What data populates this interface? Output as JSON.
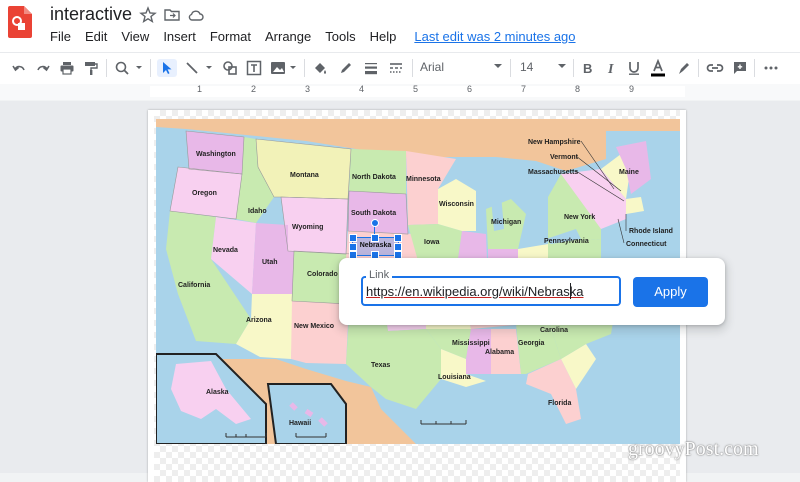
{
  "window": {
    "title": "interactive"
  },
  "menubar": {
    "items": [
      "File",
      "Edit",
      "View",
      "Insert",
      "Format",
      "Arrange",
      "Tools",
      "Help"
    ],
    "last_edit": "Last edit was 2 minutes ago"
  },
  "toolbar": {
    "font": "Arial",
    "font_size": "14",
    "icons": [
      "undo-icon",
      "redo-icon",
      "print-icon",
      "paint-format-icon",
      "zoom-icon",
      "select-icon",
      "line-icon",
      "shape-icon",
      "text-box-icon",
      "image-icon",
      "fill-color-icon",
      "border-color-icon",
      "border-weight-icon",
      "border-dash-icon",
      "bold-icon",
      "italic-icon",
      "underline-icon",
      "text-color-icon",
      "highlight-icon",
      "link-icon",
      "comment-icon",
      "more-icon"
    ]
  },
  "ruler": {
    "numbers": [
      "1",
      "2",
      "3",
      "4",
      "5",
      "6",
      "7",
      "8",
      "9"
    ]
  },
  "map": {
    "labels": {
      "washington": "Washington",
      "oregon": "Oregon",
      "california": "California",
      "nevada": "Nevada",
      "idaho": "Idaho",
      "montana": "Montana",
      "wyoming": "Wyoming",
      "utah": "Utah",
      "arizona": "Arizona",
      "colorado": "Colorado",
      "new_mexico": "New Mexico",
      "north_dakota": "North Dakota",
      "south_dakota": "South Dakota",
      "minnesota": "Minnesota",
      "iowa": "Iowa",
      "wisconsin": "Wisconsin",
      "michigan": "Michigan",
      "texas": "Texas",
      "mississippi": "Mississippi",
      "alabama": "Alabama",
      "georgia": "Georgia",
      "louisiana": "Louisiana",
      "florida": "Florida",
      "new_york": "New York",
      "pennsylvania": "Pennsylvania",
      "new_hampshire": "New Hampshire",
      "vermont": "Vermont",
      "massachusetts": "Massachusetts",
      "maine": "Maine",
      "rhode_island": "Rhode Island",
      "connecticut": "Connecticut",
      "carolina": "Carolina",
      "alaska": "Alaska",
      "hawaii": "Hawaii"
    },
    "selected_shape_label": "Nebraska"
  },
  "link_dialog": {
    "label": "Link",
    "value": "https://en.wikipedia.org/wiki/Nebraska",
    "apply_label": "Apply"
  },
  "watermark": "groovyPost.com",
  "colors": {
    "accent": "#1a73e8",
    "ocean": "#a9d3ea",
    "app_icon": "#ea4335"
  }
}
